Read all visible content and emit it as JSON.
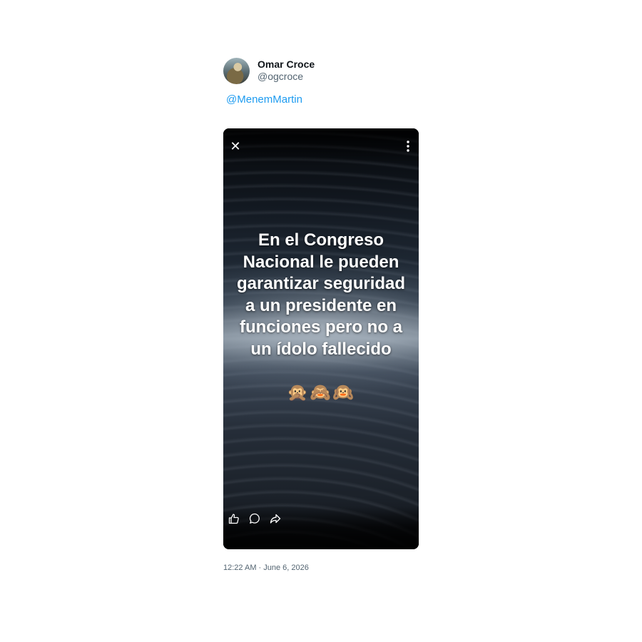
{
  "author": {
    "display_name": "Omar Croce",
    "handle": "@ogcroce",
    "avatar_icon": "user-avatar"
  },
  "tweet": {
    "mention": "@MenemMartin",
    "timestamp": "12:22 AM · June 6, 2026"
  },
  "media": {
    "overlay_text": "En el Congreso Nacional le pueden garantizar seguridad a un presidente en funciones pero no a un ídolo fallecido",
    "emojis": "🙊🙈🙉",
    "close_glyph": "✕",
    "icons": {
      "close": "close-icon",
      "more": "more-vertical-icon",
      "like": "thumbs-up-icon",
      "comment": "comment-icon",
      "share": "share-icon"
    }
  },
  "colors": {
    "link": "#1d9bf0",
    "secondary_text": "#536471",
    "primary_text": "#0f1419"
  }
}
